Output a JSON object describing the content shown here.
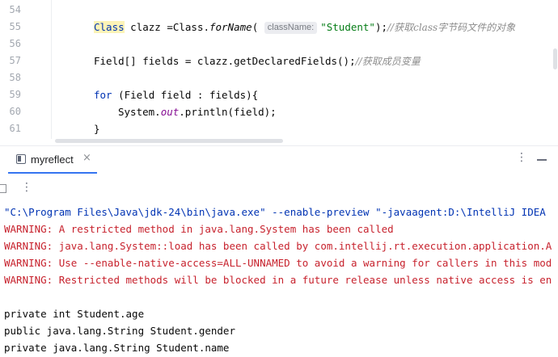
{
  "editor": {
    "line_numbers": [
      "54",
      "55",
      "56",
      "57",
      "58",
      "59",
      "60",
      "61"
    ],
    "line55": {
      "class_kw": "Class",
      "decl": " clazz =Class.",
      "method": "forName",
      "open_paren": "(",
      "param_hint": "className:",
      "arg": "\"Student\"",
      "close": ");",
      "comment": "//获取class字节码文件的对象"
    },
    "line57": {
      "code": "Field[] fields = clazz.getDeclaredFields();",
      "comment": "//获取成员变量"
    },
    "line59": {
      "kw": "for",
      "rest": " (Field field : fields){"
    },
    "line60": {
      "pre": "System.",
      "field": "out",
      "post": ".println(field);"
    },
    "line61": {
      "brace": "}"
    }
  },
  "run_panel": {
    "tab_label": "myreflect",
    "tab_close": "×",
    "more_glyph": "⋮",
    "toolbar_more_glyph": "⋮",
    "console_lines": [
      {
        "kind": "cmd",
        "text": "\"C:\\Program Files\\Java\\jdk-24\\bin\\java.exe\" --enable-preview \"-javaagent:D:\\IntelliJ IDEA"
      },
      {
        "kind": "warn",
        "text": "WARNING: A restricted method in java.lang.System has been called"
      },
      {
        "kind": "warn",
        "text": "WARNING: java.lang.System::load has been called by com.intellij.rt.execution.application.A"
      },
      {
        "kind": "warn",
        "text": "WARNING: Use --enable-native-access=ALL-UNNAMED to avoid a warning for callers in this mod"
      },
      {
        "kind": "warn",
        "text": "WARNING: Restricted methods will be blocked in a future release unless native access is en"
      },
      {
        "kind": "out",
        "text": ""
      },
      {
        "kind": "out",
        "text": "private int Student.age"
      },
      {
        "kind": "out",
        "text": "public java.lang.String Student.gender"
      },
      {
        "kind": "out",
        "text": "private java.lang.String Student.name"
      }
    ]
  },
  "colors": {
    "keyword": "#0033b3",
    "string": "#067d17",
    "warning": "#c7222d",
    "comment": "#8c8c8c",
    "tab_underline": "#3574f0"
  },
  "icons": {
    "tab_icon": "run-config-icon",
    "close": "close-icon",
    "more": "more-vertical-icon",
    "hide": "minimize-icon"
  }
}
